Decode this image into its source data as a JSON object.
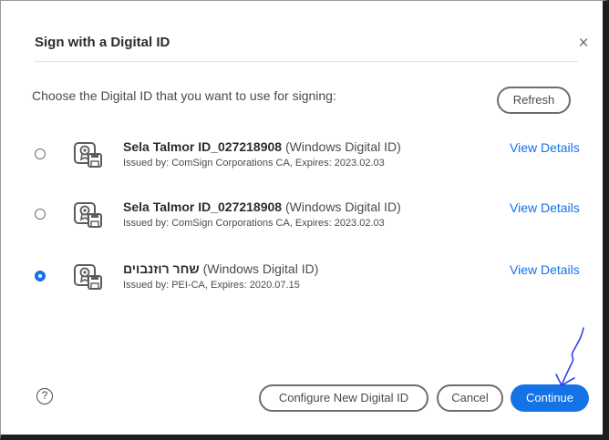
{
  "dialog": {
    "title": "Sign with a Digital ID",
    "close_icon": "close-icon",
    "prompt": "Choose the Digital ID that you want to use for signing:",
    "refresh_label": "Refresh"
  },
  "ids": [
    {
      "name": "Sela Talmor ID_027218908",
      "type": "(Windows Digital ID)",
      "issuer": "Issued by: ComSign Corporations CA, Expires: 2023.02.03",
      "view_details": "View Details",
      "selected": false,
      "icon": "digital-id-icon"
    },
    {
      "name": "Sela Talmor ID_027218908",
      "type": "(Windows Digital ID)",
      "issuer": "Issued by: ComSign Corporations CA, Expires: 2023.02.03",
      "view_details": "View Details",
      "selected": false,
      "icon": "digital-id-icon"
    },
    {
      "name": "שחר רוזנבוים",
      "type": "(Windows Digital ID)",
      "issuer": "Issued by: PEI-CA, Expires: 2020.07.15",
      "view_details": "View Details",
      "selected": true,
      "icon": "digital-id-icon"
    }
  ],
  "footer": {
    "help_icon": "?",
    "configure_label": "Configure New Digital ID",
    "cancel_label": "Cancel",
    "continue_label": "Continue"
  },
  "colors": {
    "accent": "#1473e6",
    "annotation": "#2c44e8"
  }
}
